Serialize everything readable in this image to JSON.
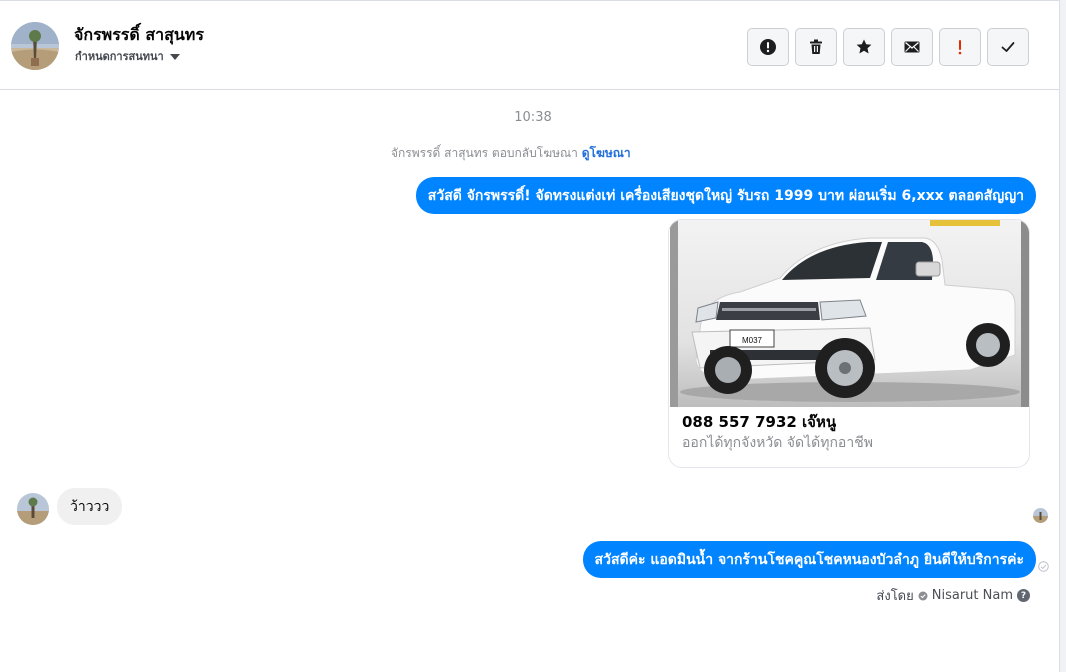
{
  "header": {
    "contact_name": "จักรพรรดิ์ สาสุนทร",
    "conversation_settings": "กำหนดการสนทนา"
  },
  "toolbar": {
    "buttons": [
      {
        "name": "spam-report",
        "icon": "exclamation-circle-icon"
      },
      {
        "name": "delete",
        "icon": "trash-icon"
      },
      {
        "name": "star",
        "icon": "star-icon"
      },
      {
        "name": "mark-unread",
        "icon": "envelope-icon"
      },
      {
        "name": "follow-up",
        "icon": "red-exclamation-icon",
        "color": "#e02d00"
      },
      {
        "name": "mark-done",
        "icon": "checkmark-icon"
      }
    ]
  },
  "conversation": {
    "timestamp": "10:38",
    "ad_reply_text": "จักรพรรดิ์ สาสุนทร ตอบกลับโฆษณา",
    "ad_reply_link": "ดูโฆษณา",
    "message_1": "สวัสดี จักรพรรดิ์! จัดทรงแต่งเท่ เครื่องเสียงชุดใหญ่ รับรถ 1999 บาท ผ่อนเริ่ม 6,xxx ตลอดสัญญา",
    "ad_card": {
      "title": "088 557 7932 เจ๊หนู",
      "description": "ออกได้ทุกจังหวัด จัดได้ทุกอาชีพ",
      "plate_text": "M037"
    },
    "incoming_message": "ว้าววว",
    "message_2": "สวัสดีค่ะ แอดมินน้ำ จากร้านโชคคูณโชคหนองบัวลำภู ยินดีให้บริการค่ะ",
    "sent_by_label": "ส่งโดย",
    "sent_by_agent": "Nisarut Nam",
    "help_glyph": "?"
  },
  "colors": {
    "outgoing_bubble": "#0084ff",
    "incoming_bubble": "#f0f0f0",
    "link": "#216fdb"
  }
}
